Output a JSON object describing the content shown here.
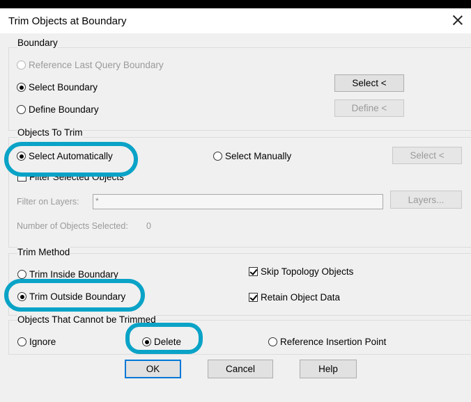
{
  "window": {
    "title": "Trim Objects at Boundary"
  },
  "boundary": {
    "label": "Boundary",
    "options": [
      {
        "label": "Reference Last Query Boundary",
        "selected": false,
        "enabled": false
      },
      {
        "label": "Select Boundary",
        "selected": true,
        "enabled": true
      },
      {
        "label": "Define Boundary",
        "selected": false,
        "enabled": true
      }
    ],
    "select_button": "Select <",
    "define_button": "Define <"
  },
  "objects_to_trim": {
    "label": "Objects To Trim",
    "select_auto": "Select Automatically",
    "select_manual": "Select Manually",
    "select_button": "Select <",
    "filter_selected": "Filter Selected Objects",
    "filter_on_layers_label": "Filter on Layers:",
    "filter_on_layers_value": "*",
    "layers_button": "Layers...",
    "count_label": "Number of Objects Selected:",
    "count_value": "0"
  },
  "trim_method": {
    "label": "Trim Method",
    "inside": "Trim Inside Boundary",
    "outside": "Trim Outside Boundary",
    "skip_topology": "Skip Topology Objects",
    "retain_data": "Retain Object Data"
  },
  "cannot_trim": {
    "label": "Objects That Cannot be Trimmed",
    "ignore": "Ignore",
    "delete": "Delete",
    "reference_point": "Reference Insertion Point"
  },
  "footer": {
    "ok": "OK",
    "cancel": "Cancel",
    "help": "Help"
  },
  "colors": {
    "highlight": "#0aa3c7",
    "default_button_border": "#0078d7"
  }
}
